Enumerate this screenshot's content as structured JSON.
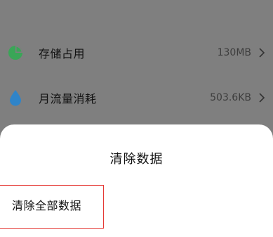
{
  "rows": [
    {
      "icon": "pie-chart-icon",
      "label": "存储占用",
      "value": "130MB"
    },
    {
      "icon": "water-drop-icon",
      "label": "月流量消耗",
      "value": "503.6KB"
    }
  ],
  "dialog": {
    "title": "清除数据",
    "options": [
      {
        "label": "清除全部数据"
      }
    ]
  },
  "colors": {
    "storage_icon": "#3aa657",
    "traffic_icon": "#2f84c8",
    "highlight_border": "#e53935"
  }
}
